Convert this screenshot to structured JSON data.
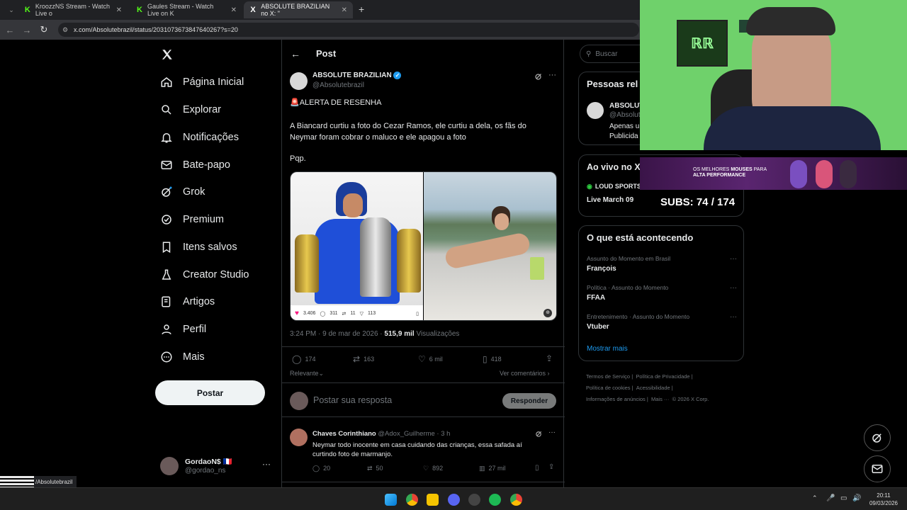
{
  "browser": {
    "tabs": [
      {
        "label": "KroozzNS Stream - Watch Live o",
        "icon": "K"
      },
      {
        "label": "Gaules Stream - Watch Live on K",
        "icon": "K"
      },
      {
        "label": "ABSOLUTE BRAZILIAN no X: \"",
        "icon": "X"
      }
    ],
    "url": "x.com/Absolutebrazil/status/2031073673847640267?s=20",
    "status_url": "/Absolutebrazil"
  },
  "nav": {
    "items": [
      "Página Inicial",
      "Explorar",
      "Notificações",
      "Bate-papo",
      "Grok",
      "Premium",
      "Itens salvos",
      "Creator Studio",
      "Artigos",
      "Perfil",
      "Mais"
    ],
    "post_button": "Postar",
    "account": {
      "name": "GordaoN$ 🇫🇷",
      "handle": "@gordao_ns"
    }
  },
  "post": {
    "header": "Post",
    "author": "ABSOLUTE BRAZILIAN",
    "handle": "@Absolutebrazil",
    "alert": "🚨ALERTA DE RESENHA",
    "body": "A Biancard curtiu a foto do Cezar Ramos, ele curtiu a dela, os fãs do Neymar foram cobrar o maluco e ele apagou a foto",
    "tail": "Pqp.",
    "overlay_stats": {
      "likes": "3.406",
      "replies": "311",
      "reposts": "11",
      "extra": "113"
    },
    "timestamp": "3:24 PM · 9 de mar de 2026 · ",
    "views_count": "515,9 mil",
    "views_label": "Visualizações",
    "actions": {
      "replies": "174",
      "reposts": "163",
      "likes": "6 mil",
      "bookmarks": "418"
    },
    "sort_label": "Relevante",
    "view_comments": "Ver comentários",
    "reply_placeholder": "Postar sua resposta",
    "reply_button": "Responder"
  },
  "reply": {
    "author": "Chaves Corinthiano",
    "handle": "@Adox_Guilherme · 3 h",
    "text": "Neymar todo inocente em casa cuidando das crianças, essa safada aí curtindo foto de marmanjo.",
    "actions": {
      "replies": "20",
      "reposts": "50",
      "likes": "892",
      "views": "27 mil"
    }
  },
  "sidebar": {
    "search_placeholder": "Buscar",
    "people_title": "Pessoas rel",
    "person_name": "ABSOLUT",
    "person_handle": "@Absolut",
    "person_bio_1": "Apenas u",
    "person_bio_2": "Publicida",
    "live_title": "Ao vivo no X",
    "live_source": "LOUD SPORTS",
    "live_date": "Live March 09",
    "trending_title": "O que está acontecendo",
    "trends": [
      {
        "context": "Assunto do Momento em Brasil",
        "name": "François"
      },
      {
        "context": "Política · Assunto do Momento",
        "name": "FFAA"
      },
      {
        "context": "Entretenimento · Assunto do Momento",
        "name": "Vtuber"
      }
    ],
    "show_more": "Mostrar mais",
    "footer_links": [
      "Termos de Serviço",
      "Política de Privacidade",
      "Política de cookies",
      "Acessibilidade",
      "Informações de anúncios",
      "Mais ···",
      "© 2026 X Corp."
    ]
  },
  "overlay": {
    "subs_label": "SUBS:",
    "subs_value": "74 / 174",
    "banner_text_1": "OS MELHORES",
    "banner_text_bold": "MOUSES",
    "banner_text_2": "PARA",
    "banner_text_3": "ALTA PERFORMANCE",
    "logo_text": "ℝℝ"
  },
  "taskbar": {
    "time": "20:11",
    "date": "09/03/2026"
  },
  "colors": {
    "accent": "#1d9bf0",
    "like": "#f91880",
    "webcam_bg": "#6fd16b"
  }
}
